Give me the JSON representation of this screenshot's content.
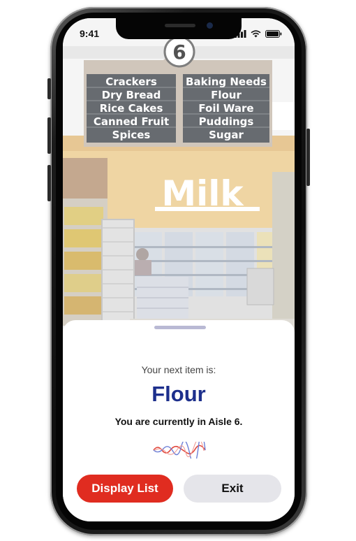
{
  "status_bar": {
    "time": "9:41"
  },
  "aisle_sign": {
    "number": "6",
    "left_items": [
      "Crackers",
      "Dry Bread",
      "Rice Cakes",
      "Canned Fruit",
      "Spices"
    ],
    "right_items": [
      "Baking Needs",
      "Flour",
      "Foil Ware",
      "Puddings",
      "Sugar"
    ]
  },
  "store_sign": {
    "text": "Milk"
  },
  "sheet": {
    "prompt": "Your next item is:",
    "item_name": "Flour",
    "location": "You are currently in Aisle 6.",
    "display_list_label": "Display List",
    "exit_label": "Exit"
  },
  "colors": {
    "item_name": "#1d2f8c",
    "display_button": "#e02c20",
    "exit_button": "#e5e5ea"
  }
}
